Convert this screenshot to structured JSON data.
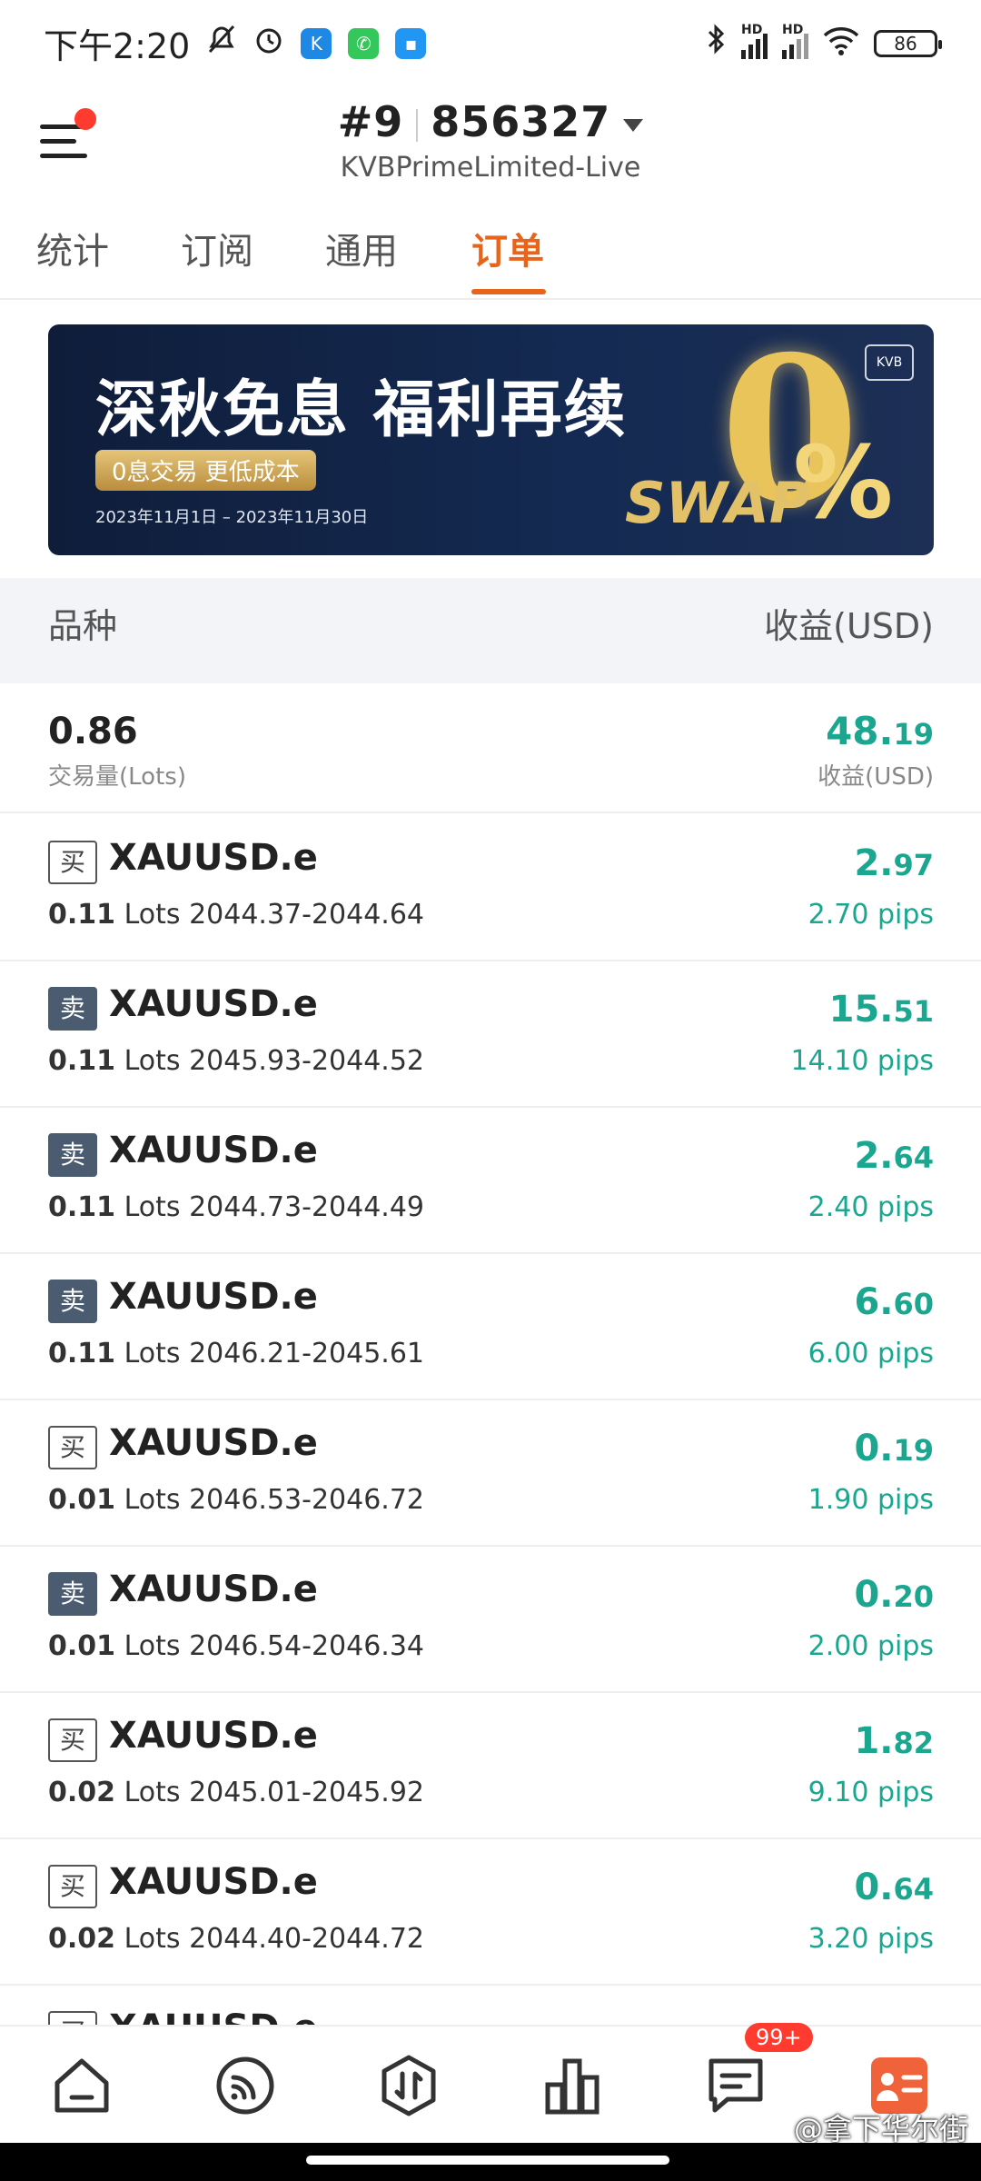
{
  "status_bar": {
    "time": "下午2:20",
    "battery": "86",
    "net_label_1": "HD",
    "net_label_2": "HD"
  },
  "header": {
    "account_prefix": "#9",
    "account_number": "856327",
    "server": "KVBPrimeLimited-Live"
  },
  "tabs": [
    {
      "label": "统计",
      "active": false
    },
    {
      "label": "订阅",
      "active": false
    },
    {
      "label": "通用",
      "active": false
    },
    {
      "label": "订单",
      "active": true
    }
  ],
  "banner": {
    "title": "深秋免息 福利再续",
    "pill": "0息交易 更低成本",
    "date": "2023年11月1日 – 2023年11月30日",
    "zero": "0",
    "percent": "%",
    "swap": "SWAP",
    "logo": "KVB"
  },
  "columns": {
    "left": "品种",
    "right": "收益(USD)"
  },
  "summary": {
    "volume": "0.86",
    "volume_label": "交易量(Lots)",
    "profit_int": "48.",
    "profit_dec": "19",
    "profit_label": "收益(USD)"
  },
  "orders": [
    {
      "side": "买",
      "symbol": "XAUUSD.e",
      "lots": "0.11",
      "unit": "Lots",
      "range": "2044.37-2044.64",
      "profit_int": "2.",
      "profit_dec": "97",
      "pips": "2.70 pips"
    },
    {
      "side": "卖",
      "symbol": "XAUUSD.e",
      "lots": "0.11",
      "unit": "Lots",
      "range": "2045.93-2044.52",
      "profit_int": "15.",
      "profit_dec": "51",
      "pips": "14.10 pips"
    },
    {
      "side": "卖",
      "symbol": "XAUUSD.e",
      "lots": "0.11",
      "unit": "Lots",
      "range": "2044.73-2044.49",
      "profit_int": "2.",
      "profit_dec": "64",
      "pips": "2.40 pips"
    },
    {
      "side": "卖",
      "symbol": "XAUUSD.e",
      "lots": "0.11",
      "unit": "Lots",
      "range": "2046.21-2045.61",
      "profit_int": "6.",
      "profit_dec": "60",
      "pips": "6.00 pips"
    },
    {
      "side": "买",
      "symbol": "XAUUSD.e",
      "lots": "0.01",
      "unit": "Lots",
      "range": "2046.53-2046.72",
      "profit_int": "0.",
      "profit_dec": "19",
      "pips": "1.90 pips"
    },
    {
      "side": "卖",
      "symbol": "XAUUSD.e",
      "lots": "0.01",
      "unit": "Lots",
      "range": "2046.54-2046.34",
      "profit_int": "0.",
      "profit_dec": "20",
      "pips": "2.00 pips"
    },
    {
      "side": "买",
      "symbol": "XAUUSD.e",
      "lots": "0.02",
      "unit": "Lots",
      "range": "2045.01-2045.92",
      "profit_int": "1.",
      "profit_dec": "82",
      "pips": "9.10 pips"
    },
    {
      "side": "买",
      "symbol": "XAUUSD.e",
      "lots": "0.02",
      "unit": "Lots",
      "range": "2044.40-2044.72",
      "profit_int": "0.",
      "profit_dec": "64",
      "pips": "3.20 pips"
    },
    {
      "side": "买",
      "symbol": "XAUUSD.e",
      "lots": "",
      "unit": "",
      "range": "",
      "profit_int": "",
      "profit_dec": "",
      "pips": ""
    }
  ],
  "bottom_nav": {
    "items": [
      "home-icon",
      "feed-icon",
      "trade-icon",
      "chart-icon",
      "message-icon",
      "profile-icon"
    ],
    "message_badge": "99+",
    "watermark": "@拿下华尔街"
  },
  "colors": {
    "accent": "#e8641a",
    "profit": "#1aa68f",
    "sell_badge": "#4b5b70"
  }
}
